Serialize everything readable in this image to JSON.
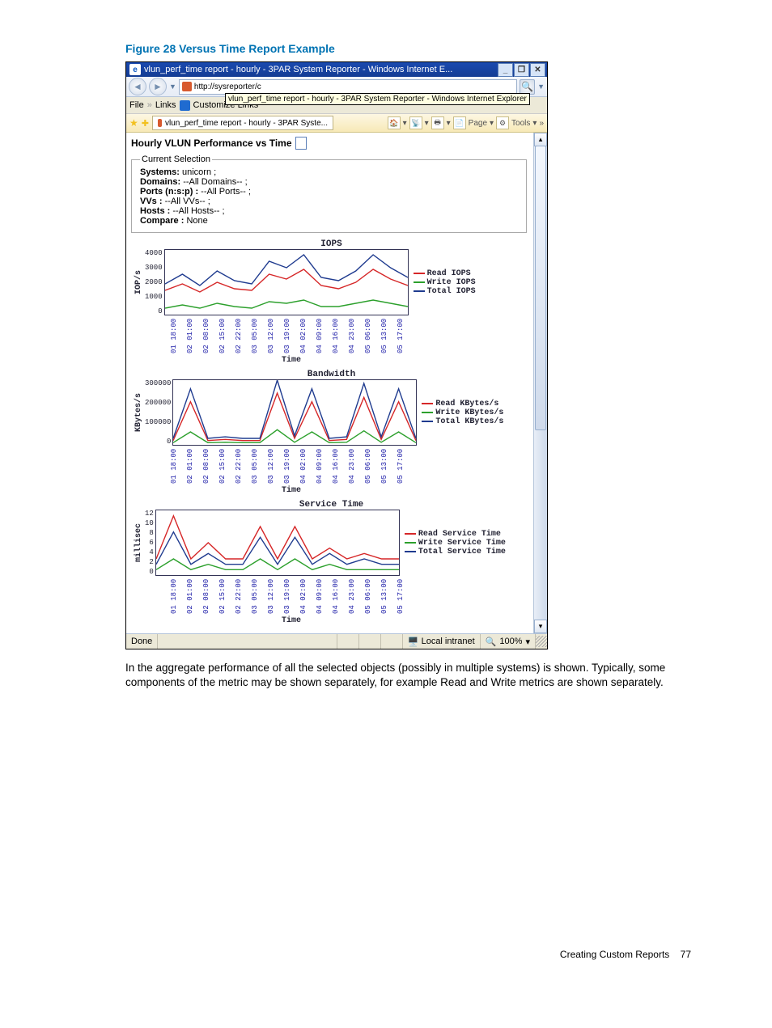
{
  "figure_caption": "Figure 28 Versus Time Report Example",
  "window": {
    "title": "vlun_perf_time report - hourly - 3PAR System Reporter - Windows Internet E...",
    "min": "_",
    "restore": "❐",
    "close": "✕"
  },
  "address": {
    "url": "http://sysreporter/c",
    "tooltip": "vlun_perf_time report - hourly - 3PAR System Reporter - Windows Internet Explorer",
    "go": "→"
  },
  "menu": {
    "file": "File",
    "chevrons": "»",
    "links": "Links",
    "customize": "Customize Links"
  },
  "tabs": {
    "active": "vlun_perf_time report - hourly - 3PAR Syste...",
    "page": "Page",
    "tools": "Tools"
  },
  "report": {
    "heading": "Hourly VLUN Performance vs Time",
    "current_selection_legend": "Current Selection",
    "k_systems": "Systems:",
    "v_systems": "unicorn ;",
    "k_domains": "Domains:",
    "v_domains": "--All Domains-- ;",
    "k_ports": "Ports (n:s:p) :",
    "v_ports": "--All Ports-- ;",
    "k_vvs": "VVs :",
    "v_vvs": "--All VVs-- ;",
    "k_hosts": "Hosts :",
    "v_hosts": "--All Hosts-- ;",
    "k_compare": "Compare :",
    "v_compare": "None"
  },
  "status": {
    "done": "Done",
    "zone": "Local intranet",
    "zoom": "100%"
  },
  "body_paragraph": "In the aggregate performance of all the selected objects (possibly in multiple systems) is shown. Typically, some components of the metric may be shown separately, for example Read and Write metrics are shown separately.",
  "footer": {
    "section": "Creating Custom Reports",
    "page": "77"
  },
  "x_ticks": [
    "01 18:00",
    "02 01:00",
    "02 08:00",
    "02 15:00",
    "02 22:00",
    "03 05:00",
    "03 12:00",
    "03 19:00",
    "04 02:00",
    "04 09:00",
    "04 16:00",
    "04 23:00",
    "05 06:00",
    "05 13:00",
    "05 17:00"
  ],
  "x_label": "Time",
  "charts": {
    "iops": {
      "title": "IOPS",
      "ylabel": "IOP/s",
      "yticks": [
        "4000",
        "3000",
        "2000",
        "1000",
        "0"
      ],
      "legend": [
        "Read IOPS",
        "Write IOPS",
        "Total IOPS"
      ]
    },
    "bandwidth": {
      "title": "Bandwidth",
      "ylabel": "KBytes/s",
      "yticks": [
        "300000",
        "200000",
        "100000",
        "0"
      ],
      "legend": [
        "Read KBytes/s",
        "Write KBytes/s",
        "Total KBytes/s"
      ]
    },
    "svctime": {
      "title": "Service Time",
      "ylabel": "millisec",
      "yticks": [
        "12",
        "10",
        "8",
        "6",
        "4",
        "2",
        "0"
      ],
      "legend": [
        "Read Service Time",
        "Write Service Time",
        "Total Service Time"
      ]
    }
  },
  "chart_data": [
    {
      "type": "line",
      "title": "IOPS",
      "xlabel": "Time",
      "ylabel": "IOP/s",
      "ylim": [
        0,
        4000
      ],
      "categories": [
        "01 18:00",
        "02 01:00",
        "02 08:00",
        "02 15:00",
        "02 22:00",
        "03 05:00",
        "03 12:00",
        "03 19:00",
        "04 02:00",
        "04 09:00",
        "04 16:00",
        "04 23:00",
        "05 06:00",
        "05 13:00",
        "05 17:00"
      ],
      "series": [
        {
          "name": "Read IOPS",
          "values": [
            1500,
            1900,
            1400,
            2000,
            1600,
            1500,
            2500,
            2200,
            2800,
            1800,
            1600,
            2000,
            2800,
            2200,
            1800
          ]
        },
        {
          "name": "Write IOPS",
          "values": [
            400,
            600,
            400,
            700,
            500,
            400,
            800,
            700,
            900,
            500,
            500,
            700,
            900,
            700,
            500
          ]
        },
        {
          "name": "Total IOPS",
          "values": [
            1900,
            2500,
            1800,
            2700,
            2100,
            1900,
            3300,
            2900,
            3700,
            2300,
            2100,
            2700,
            3700,
            2900,
            2300
          ]
        }
      ]
    },
    {
      "type": "line",
      "title": "Bandwidth",
      "xlabel": "Time",
      "ylabel": "KBytes/s",
      "ylim": [
        0,
        300000
      ],
      "categories": [
        "01 18:00",
        "02 01:00",
        "02 08:00",
        "02 15:00",
        "02 22:00",
        "03 05:00",
        "03 12:00",
        "03 19:00",
        "04 02:00",
        "04 09:00",
        "04 16:00",
        "04 23:00",
        "05 06:00",
        "05 13:00",
        "05 17:00"
      ],
      "series": [
        {
          "name": "Read KBytes/s",
          "values": [
            20000,
            200000,
            20000,
            25000,
            20000,
            20000,
            240000,
            30000,
            200000,
            20000,
            25000,
            220000,
            25000,
            200000,
            20000
          ]
        },
        {
          "name": "Write KBytes/s",
          "values": [
            10000,
            60000,
            10000,
            12000,
            10000,
            10000,
            70000,
            12000,
            60000,
            10000,
            12000,
            65000,
            12000,
            60000,
            10000
          ]
        },
        {
          "name": "Total KBytes/s",
          "values": [
            30000,
            260000,
            30000,
            37000,
            30000,
            30000,
            300000,
            42000,
            260000,
            30000,
            37000,
            285000,
            37000,
            260000,
            30000
          ]
        }
      ]
    },
    {
      "type": "line",
      "title": "Service Time",
      "xlabel": "Time",
      "ylabel": "millisec",
      "ylim": [
        0,
        12
      ],
      "categories": [
        "01 18:00",
        "02 01:00",
        "02 08:00",
        "02 15:00",
        "02 22:00",
        "03 05:00",
        "03 12:00",
        "03 19:00",
        "04 02:00",
        "04 09:00",
        "04 16:00",
        "04 23:00",
        "05 06:00",
        "05 13:00",
        "05 17:00"
      ],
      "series": [
        {
          "name": "Read Service Time",
          "values": [
            3,
            11,
            3,
            6,
            3,
            3,
            9,
            3,
            9,
            3,
            5,
            3,
            4,
            3,
            3
          ]
        },
        {
          "name": "Write Service Time",
          "values": [
            1,
            3,
            1,
            2,
            1,
            1,
            3,
            1,
            3,
            1,
            2,
            1,
            1,
            1,
            1
          ]
        },
        {
          "name": "Total Service Time",
          "values": [
            2,
            8,
            2,
            4,
            2,
            2,
            7,
            2,
            7,
            2,
            4,
            2,
            3,
            2,
            2
          ]
        }
      ]
    }
  ]
}
